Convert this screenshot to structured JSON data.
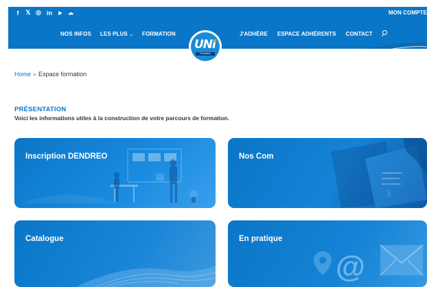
{
  "topbar": {
    "social": [
      {
        "name": "facebook-icon",
        "glyph": "f"
      },
      {
        "name": "x-twitter-icon",
        "glyph": "𝕏"
      },
      {
        "name": "instagram-icon",
        "glyph": "◎"
      },
      {
        "name": "linkedin-icon",
        "glyph": "in"
      },
      {
        "name": "youtube-icon",
        "glyph": "▶"
      },
      {
        "name": "cloud-icon",
        "glyph": "☁"
      },
      {
        "name": "apple-icon",
        "glyph": ""
      }
    ],
    "account_label": "MON COMPTE"
  },
  "nav": {
    "left": [
      "NOS INFOS",
      "LES PLUS",
      "FORMATION"
    ],
    "les_plus_chevron": "⌄",
    "right": [
      "J'ADHÈRE",
      "ESPACE ADHÉRENTS",
      "CONTACT"
    ]
  },
  "logo": {
    "text": "UNI",
    "ribbon": "Formation"
  },
  "breadcrumb": {
    "home": "Home",
    "separator": "»",
    "current": "Espace formation"
  },
  "section": {
    "title": "PRÉSENTATION",
    "subtitle": "Voici les informations utiles à la construction de votre parcours de formation."
  },
  "cards": [
    {
      "label": "Inscription DENDREO"
    },
    {
      "label": "Nos Com"
    },
    {
      "label": "Catalogue"
    },
    {
      "label": "En pratique"
    }
  ],
  "colors": {
    "brand": "#0a76c7",
    "text": "#333333"
  }
}
